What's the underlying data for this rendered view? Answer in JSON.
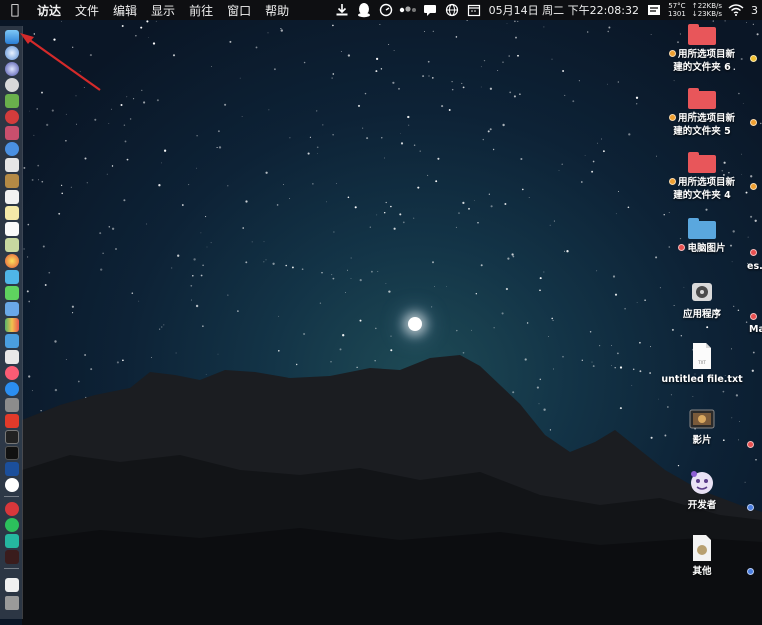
{
  "menubar": {
    "app_name": "访达",
    "items": [
      "文件",
      "编辑",
      "显示",
      "前往",
      "窗口",
      "帮助"
    ]
  },
  "status": {
    "date_time": "05月14日 周二 下午22:08:32",
    "temperature": "57°C",
    "fan": "1301",
    "net_up": "↑22KB/s",
    "net_down": "↓23KB/s",
    "partial": "3"
  },
  "desktop": {
    "items": [
      {
        "label_line1": "用所选项目新",
        "label_line2": "建的文件夹 6",
        "tag_color": "#f0a030",
        "kind": "folder-red"
      },
      {
        "label_line1": "用所选项目新",
        "label_line2": "建的文件夹 5",
        "tag_color": "#f0a030",
        "kind": "folder-red"
      },
      {
        "label_line1": "用所选项目新",
        "label_line2": "建的文件夹 4",
        "tag_color": "#f0a030",
        "kind": "folder-red"
      },
      {
        "label_line1": "电脑图片",
        "tag_color": "#e85050",
        "kind": "folder-blue"
      },
      {
        "label_line1": "应用程序",
        "kind": "disk"
      },
      {
        "label_line1": "untitled file.txt",
        "kind": "txt"
      },
      {
        "label_line1": "影片",
        "kind": "movie"
      },
      {
        "label_line1": "开发者",
        "kind": "dev"
      },
      {
        "label_line1": "其他",
        "kind": "other"
      }
    ],
    "edge_labels": [
      "es.t",
      "Ma"
    ]
  },
  "colors": {
    "folder_red": "#e8565a",
    "folder_blue": "#5aa7de",
    "arrow": "#d42a2a"
  }
}
